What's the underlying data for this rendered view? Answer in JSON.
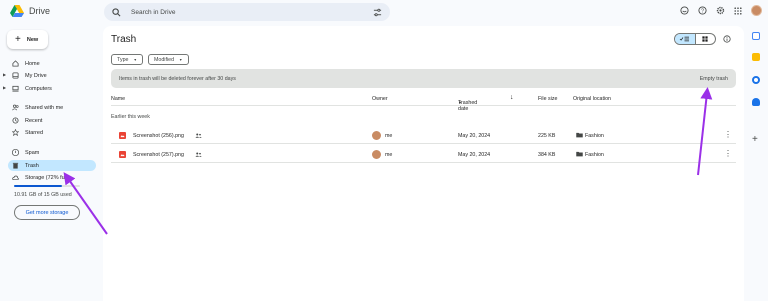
{
  "app": {
    "name": "Drive"
  },
  "search": {
    "placeholder": "Search in Drive"
  },
  "sidebar": {
    "new_label": "New",
    "items": [
      {
        "label": "Home",
        "icon": "home-icon"
      },
      {
        "label": "My Drive",
        "icon": "my-drive-icon"
      },
      {
        "label": "Computers",
        "icon": "computer-icon"
      },
      {
        "label": "Shared with me",
        "icon": "people-icon"
      },
      {
        "label": "Recent",
        "icon": "clock-icon"
      },
      {
        "label": "Starred",
        "icon": "star-icon"
      },
      {
        "label": "Spam",
        "icon": "spam-icon"
      },
      {
        "label": "Trash",
        "icon": "trash-icon"
      },
      {
        "label": "Storage (72% full)",
        "icon": "cloud-icon"
      }
    ],
    "storage_fraction": 0.72,
    "storage_text": "10.91 GB of 15 GB used",
    "get_more_storage": "Get more storage"
  },
  "main": {
    "title": "Trash",
    "filters": [
      "Type",
      "Modified"
    ],
    "banner_message": "Items in trash will be deleted forever after 30 days",
    "empty_trash": "Empty trash",
    "columns": {
      "name": "Name",
      "owner": "Owner",
      "trashed_date": "Trashed date",
      "file_size": "File size",
      "original_location": "Original location"
    },
    "section": "Earlier this week",
    "rows": [
      {
        "name": "Screenshot (256).png",
        "owner": "me",
        "date": "May 20, 2024",
        "size": "225 KB",
        "location": "Fashion"
      },
      {
        "name": "Screenshot (257).png",
        "owner": "me",
        "date": "May 20, 2024",
        "size": "384 KB",
        "location": "Fashion"
      }
    ]
  },
  "colors": {
    "accent": "#0b57d0",
    "active_nav": "#c2e7ff",
    "annotation_arrow": "#9b30e8"
  }
}
